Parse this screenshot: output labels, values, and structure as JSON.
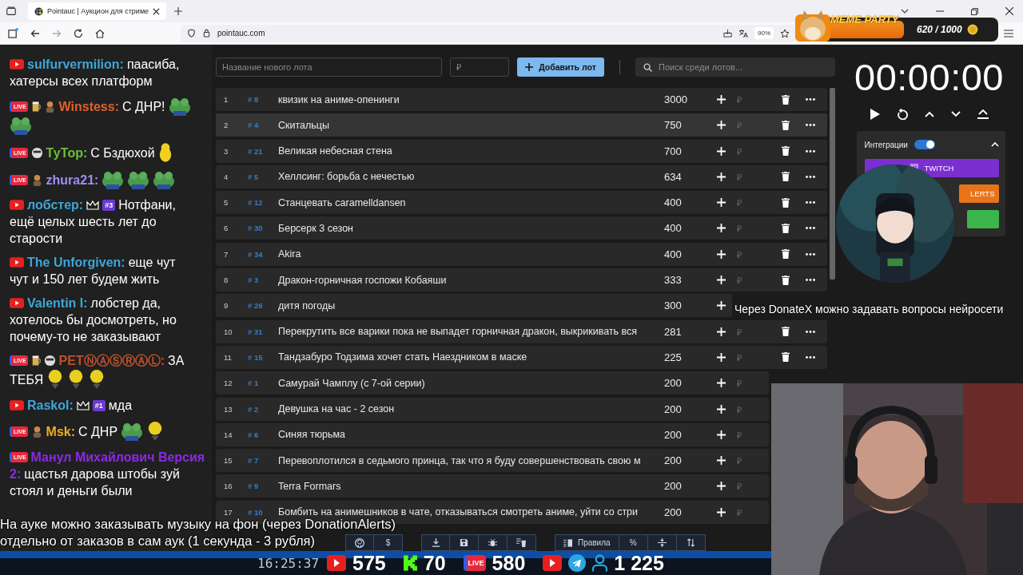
{
  "browser": {
    "tab_title": "Pointauc | Аукцион для стриме",
    "url": "pointauc.com",
    "zoom": "90%"
  },
  "overlay_widget": {
    "title": "MEME PARTY",
    "progress": "620 / 1000"
  },
  "chat": [
    {
      "kind": "youtube",
      "user": "sulfurvermilion:",
      "color": "#3ea6d8",
      "lines": [
        "паасиба,",
        "хатерсы всех платформ"
      ]
    },
    {
      "kind": "live",
      "badge_label": "LIVE",
      "icons": [
        {
          "kind": "glass"
        },
        {
          "kind": "figure"
        }
      ],
      "user": "Winstess:",
      "color": "#e0602a",
      "lines": [
        "С ДНР!"
      ],
      "emotes": [
        {
          "kind": "frog"
        },
        {
          "kind": "frog"
        }
      ]
    },
    {
      "kind": "live",
      "badge_label": "LIVE",
      "icons": [
        {
          "kind": "mask"
        }
      ],
      "user": "ТуТор:",
      "color": "#6fbf3a",
      "lines": [
        "С Бздюхой"
      ],
      "emotes": [
        {
          "kind": "blob"
        }
      ]
    },
    {
      "kind": "live",
      "badge_label": "LIVE",
      "icons": [
        {
          "kind": "figure"
        }
      ],
      "user": "zhura21:",
      "color": "#a08cf0",
      "emotes": [
        {
          "kind": "frog"
        },
        {
          "kind": "frog"
        },
        {
          "kind": "frog"
        }
      ]
    },
    {
      "kind": "youtube",
      "user": "лобстер:",
      "color": "#3ea6d8",
      "rank": "#3",
      "lines": [
        "Нотфани,",
        "ещё целых шесть лет до",
        "старости"
      ]
    },
    {
      "kind": "youtube",
      "user": "The Unforgiven:",
      "color": "#3ea6d8",
      "lines": [
        "еще чут",
        "чут и 150 лет будем жить"
      ]
    },
    {
      "kind": "youtube",
      "user": "Valentin I:",
      "color": "#3ea6d8",
      "lines": [
        "лобстер да,",
        "хотелось бы досмотреть, но",
        "почему-то не заказывают"
      ]
    },
    {
      "kind": "live",
      "badge_label": "LIVE",
      "icons": [
        {
          "kind": "glass"
        },
        {
          "kind": "mask"
        }
      ],
      "user": "PETⓃⒶⓈⓇⒶⓁ:",
      "color": "#c0502a",
      "lines": [
        "ЗА",
        "ТЕБЯ"
      ],
      "emotes": [
        {
          "kind": "smile"
        },
        {
          "kind": "smile"
        },
        {
          "kind": "smile"
        }
      ]
    },
    {
      "kind": "youtube",
      "user": "Raskol:",
      "color": "#3ea6d8",
      "rank": "#1",
      "lines": [
        "мда"
      ]
    },
    {
      "kind": "live",
      "badge_label": "LIVE",
      "icons": [
        {
          "kind": "figure"
        }
      ],
      "user": "Msk:",
      "color": "#e8b020",
      "lines": [
        "С ДНР"
      ],
      "emotes": [
        {
          "kind": "frog"
        },
        {
          "kind": "smile"
        }
      ]
    },
    {
      "kind": "live",
      "badge_label": "LIVE",
      "user": [
        "Манул Михайлович Версия",
        "2:"
      ],
      "color": "#8a2be2",
      "lines": [
        "щастья дарова штобы зуй",
        "стоял и деньги были"
      ]
    }
  ],
  "auction": {
    "lot_name": {
      "placeholder": "Название нового лота"
    },
    "amount": {
      "placeholder": "₽"
    },
    "add_button": "Добавить лот",
    "search": {
      "placeholder": "Поиск среди лотов..."
    },
    "lots": [
      {
        "index": "1",
        "id": "# 8",
        "name": "квизик на аниме-опенинги",
        "amount": "3000",
        "currency": "₽",
        "selected": false
      },
      {
        "index": "2",
        "id": "# 4",
        "name": "Скитальцы",
        "amount": "750",
        "currency": "₽",
        "selected": true
      },
      {
        "index": "3",
        "id": "# 21",
        "name": "Великая небесная стена",
        "amount": "700",
        "currency": "₽",
        "selected": false
      },
      {
        "index": "4",
        "id": "# 5",
        "name": "Хеллсинг: борьба с нечестью",
        "amount": "634",
        "currency": "₽",
        "selected": false
      },
      {
        "index": "5",
        "id": "# 12",
        "name": "Станцевать caramelldansen",
        "amount": "400",
        "currency": "₽",
        "selected": false
      },
      {
        "index": "6",
        "id": "# 30",
        "name": "Берсерк 3 сезон",
        "amount": "400",
        "currency": "₽",
        "selected": false
      },
      {
        "index": "7",
        "id": "# 34",
        "name": "Akira",
        "amount": "400",
        "currency": "₽",
        "selected": false
      },
      {
        "index": "8",
        "id": "# 3",
        "name": "Дракон-горничная госпожи Кобаяши",
        "amount": "333",
        "currency": "₽",
        "selected": false
      },
      {
        "index": "9",
        "id": "# 26",
        "name": "дитя погоды",
        "amount": "300",
        "selected": false
      },
      {
        "index": "10",
        "id": "# 31",
        "name": "Перекрутить все варики пока не выпадет горничная дракон, выкрикивать вся",
        "amount": "281",
        "currency": "₽",
        "selected": false
      },
      {
        "index": "11",
        "id": "# 15",
        "name": "Тандзабуро Тодзима хочет стать Наездником в маске",
        "amount": "225",
        "currency": "₽",
        "selected": false
      },
      {
        "index": "12",
        "id": "# 1",
        "name": "Самурай Чамплу (с 7-ой серии)",
        "amount": "200",
        "currency": "₽",
        "selected": false
      },
      {
        "index": "13",
        "id": "# 2",
        "name": "Девушка на час - 2 сезон",
        "amount": "200",
        "currency": "₽",
        "selected": false
      },
      {
        "index": "14",
        "id": "# 6",
        "name": "Синяя тюрьма",
        "amount": "200",
        "currency": "₽",
        "selected": false
      },
      {
        "index": "15",
        "id": "# 7",
        "name": "Перевоплотился в седьмого принца, так что я буду совершенствовать свою м",
        "amount": "200",
        "currency": "₽",
        "selected": false
      },
      {
        "index": "16",
        "id": "# 9",
        "name": "Terra Formars",
        "amount": "200",
        "currency": "₽",
        "selected": false
      },
      {
        "index": "17",
        "id": "# 10",
        "name": "Бомбить на анимешников в чате, отказываться смотреть аниме, уйти со стри",
        "amount": "200",
        "currency": "₽",
        "selected": false
      }
    ],
    "toolbar": [
      [
        {
          "kind": "github"
        },
        {
          "kind": "text",
          "label": "$"
        }
      ],
      [
        {
          "kind": "download"
        },
        {
          "kind": "save"
        },
        {
          "kind": "bug"
        },
        {
          "kind": "clear"
        }
      ],
      [
        {
          "kind": "rules",
          "label": "Правила"
        },
        {
          "kind": "text",
          "label": "%"
        },
        {
          "kind": "split"
        },
        {
          "kind": "sort"
        }
      ]
    ]
  },
  "timer": {
    "time": "00:00:00"
  },
  "integrations": {
    "label": "Интеграции",
    "on": true,
    "expanded": true,
    "services": [
      {
        "kind": "twitch",
        "label": "TWITCH",
        "color": "#7b2fd0"
      },
      {
        "kind": "alerts",
        "label": "LERTS",
        "color": "#e8741a"
      },
      {
        "kind": "plain",
        "color": "#3cb54a"
      }
    ]
  },
  "captions": [
    "На ауке можно заказывать музыку на фон (через DonationAlerts)",
    "отдельно от заказов в сам аук (1 секунда - 3 рубля)"
  ],
  "side_caption": "Через DonateX можно задавать вопросы нейросети",
  "stream_bar": {
    "time": "16:25:37",
    "stats": [
      {
        "kind": "youtube",
        "value": "575"
      },
      {
        "kind": "kick",
        "value": "70"
      },
      {
        "kind": "live",
        "label": "LIVE",
        "value": "580"
      },
      {
        "kind": "youtube"
      },
      {
        "kind": "telegram"
      },
      {
        "kind": "viewers",
        "value": "1 225"
      }
    ]
  }
}
